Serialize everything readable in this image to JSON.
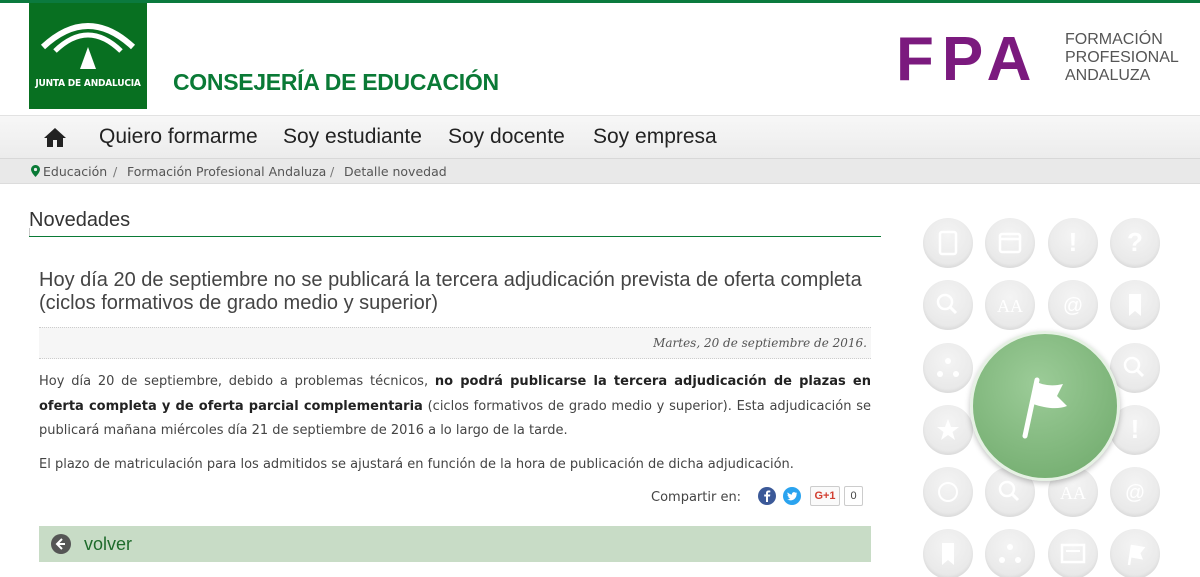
{
  "header": {
    "junta_label": "JUNTA DE ANDALUCIA",
    "consejeria": "CONSEJERÍA DE EDUCACIÓN",
    "fpa_letters": "FPA",
    "fpa_lines": [
      "FORMACIÓN",
      "PROFESIONAL",
      "ANDALUZA"
    ],
    "brand_green": "#087021",
    "brand_purple": "#7b1a7e"
  },
  "nav": {
    "home_icon": "home-icon",
    "items": [
      "Quiero formarme",
      "Soy estudiante",
      "Soy docente",
      "Soy empresa"
    ]
  },
  "breadcrumb": {
    "items": [
      "Educación",
      "Formación Profesional Andaluza",
      "Detalle novedad"
    ],
    "separator": "/"
  },
  "section": {
    "title": "Novedades"
  },
  "article": {
    "title": "Hoy día 20 de septiembre no se publicará la tercera adjudicación prevista de oferta completa (ciclos formativos de grado medio y superior)",
    "date": "Martes, 20 de septiembre de 2016.",
    "p1_before": "Hoy día 20 de septiembre, debido a problemas técnicos, ",
    "p1_bold": "no podrá publicarse la tercera adjudicación de plazas en oferta completa y de oferta parcial complementaria",
    "p1_after": " (ciclos formativos de grado medio y superior). Esta adjudicación se publicará mañana miércoles día 21 de septiembre de 2016 a lo largo de la tarde.",
    "p2": "El plazo de matriculación para los admitidos se ajustará en función de la hora de publicación de dicha adjudicación."
  },
  "share": {
    "label": "Compartir en:",
    "gplus_label": "G+1",
    "gplus_count": "0"
  },
  "volver": {
    "label": "volver"
  },
  "decor": {
    "grid_labels": [
      "!",
      "?",
      "AA",
      "@",
      "!",
      "AA",
      "@"
    ]
  }
}
